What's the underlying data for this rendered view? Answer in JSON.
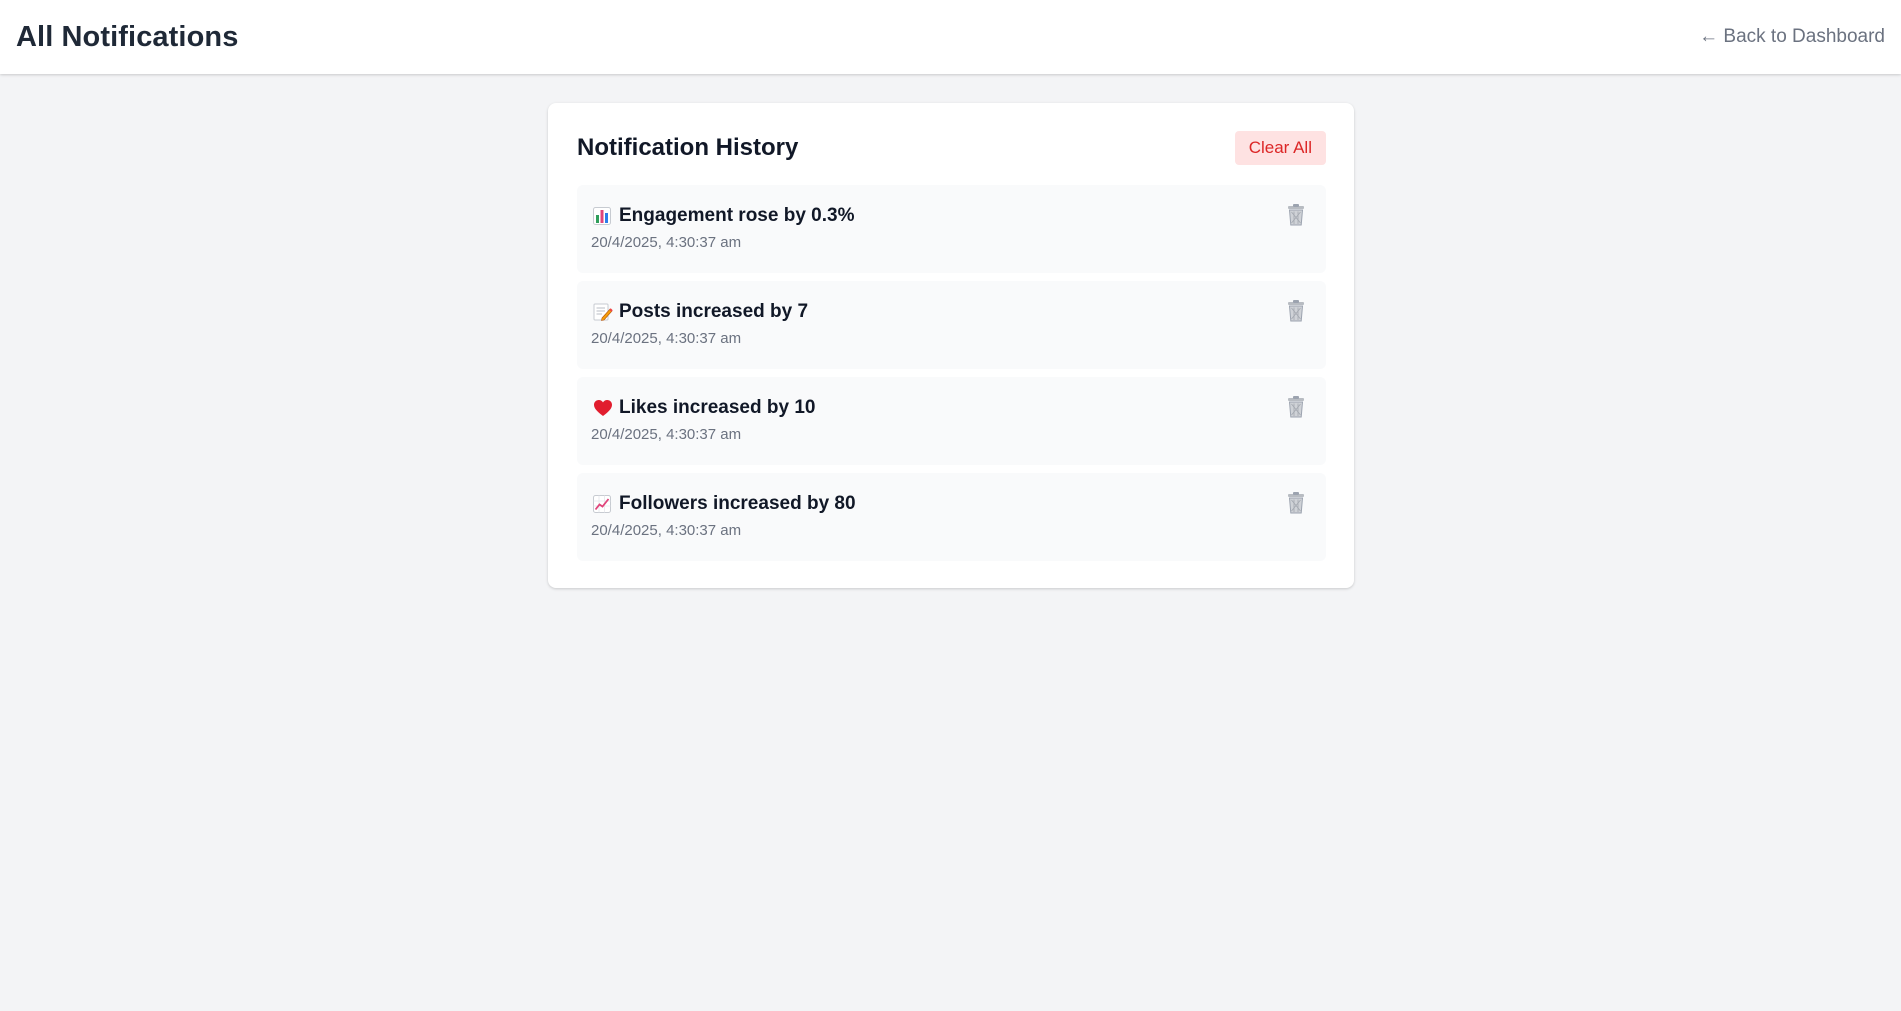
{
  "header": {
    "title": "All Notifications",
    "back_link": "← Back to Dashboard"
  },
  "card": {
    "title": "Notification History",
    "clear_all_label": "Clear All"
  },
  "notifications": [
    {
      "icon": "bar-chart-icon",
      "text": "Engagement rose by 0.3%",
      "time": "20/4/2025, 4:30:37 am"
    },
    {
      "icon": "memo-icon",
      "text": "Posts increased by 7",
      "time": "20/4/2025, 4:30:37 am"
    },
    {
      "icon": "heart-icon",
      "text": "Likes increased by 10",
      "time": "20/4/2025, 4:30:37 am"
    },
    {
      "icon": "trending-up-icon",
      "text": "Followers increased by 80",
      "time": "20/4/2025, 4:30:37 am"
    }
  ],
  "colors": {
    "background": "#f3f4f6",
    "card": "#ffffff",
    "item": "#f9fafb",
    "clear_bg": "#fee2e2",
    "clear_text": "#dc2626",
    "muted_text": "#6b7280"
  }
}
